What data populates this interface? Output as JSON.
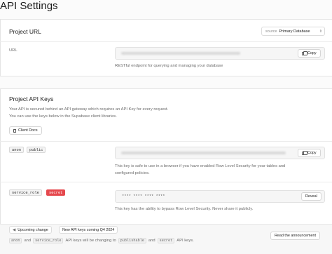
{
  "page": {
    "title": "API Settings"
  },
  "project_url": {
    "heading": "Project URL",
    "source_label": "source",
    "source_value": "Primary Database",
    "url_label": "URL",
    "copy_label": "Copy",
    "description": "RESTful endpoint for querying and managing your database"
  },
  "api_keys": {
    "heading": "Project API Keys",
    "intro_line1": "Your API is secured behind an API gateway which requires an API Key for every request.",
    "intro_line2": "You can use the keys below in the Supabase client libraries.",
    "client_docs_label": "Client Docs",
    "anon": {
      "tag1": "anon",
      "tag2": "public",
      "copy_label": "Copy",
      "desc_line1": "This key is safe to use in a browser if you have enabled Row Level Security for your tables and",
      "desc_line2": "configured policies."
    },
    "service": {
      "tag1": "service_role",
      "tag2": "secret",
      "masked": "**** **** **** ****",
      "reveal_label": "Reveal",
      "desc": "This key has the ability to bypass Row Level Security. Never share it publicly."
    }
  },
  "footer": {
    "upcoming_label": "Upcoming change",
    "new_keys_label": "New API keys coming Q4 2024",
    "code_anon": "anon",
    "text_and": "and",
    "code_service": "service_role",
    "text_mid": "API keys will be changing to",
    "code_publishable": "publishable",
    "text_and2": "and",
    "code_secret": "secret",
    "text_end": "API keys.",
    "announcement_label": "Read the announcement"
  },
  "colors": {
    "secret_tag": "#e5484d",
    "background": "#fbfbfb"
  }
}
